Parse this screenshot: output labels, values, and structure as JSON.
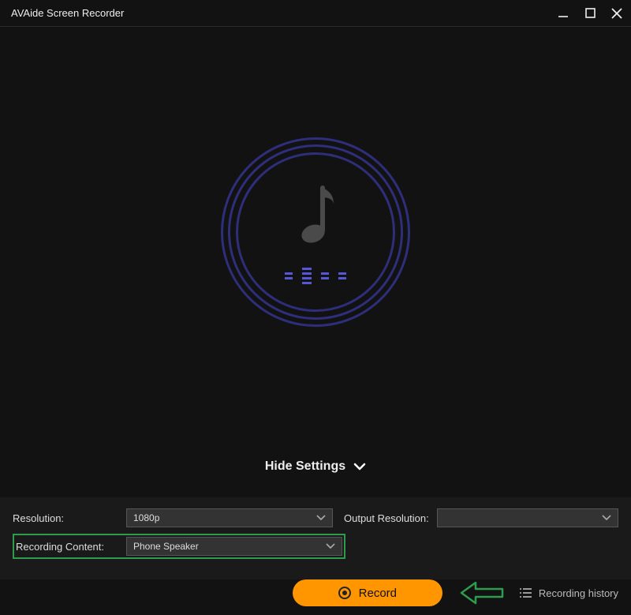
{
  "titlebar": {
    "title": "AVAide Screen Recorder"
  },
  "toggle": {
    "label": "Hide Settings"
  },
  "settings": {
    "resolution_label": "Resolution:",
    "resolution_value": "1080p",
    "output_resolution_label": "Output Resolution:",
    "output_resolution_value": "",
    "recording_content_label": "Recording Content:",
    "recording_content_value": "Phone Speaker"
  },
  "actions": {
    "record_label": "Record",
    "history_label": "Recording history"
  }
}
